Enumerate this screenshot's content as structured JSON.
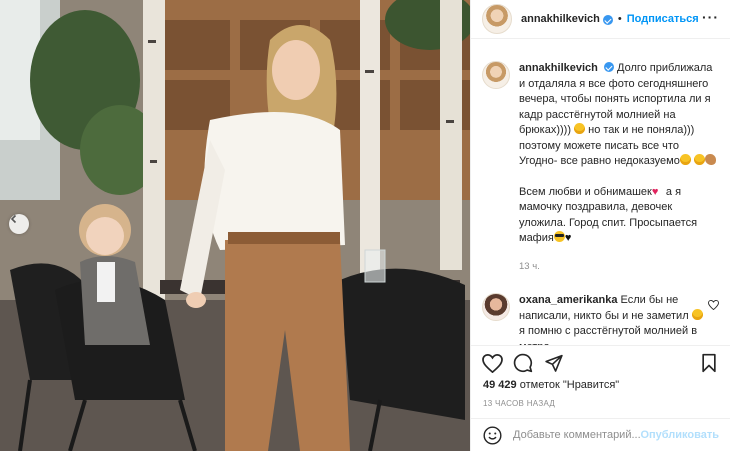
{
  "header": {
    "username": "annakhilkevich",
    "separator": "•",
    "follow_label": "Подписаться",
    "more_icon": "more-horizontal-icon"
  },
  "caption": {
    "username": "annakhilkevich",
    "text_part1": "Долго приближала и отдаляла я все фото сегодняшнего вечера, чтобы понять испортила ли я кадр расстёгнутой молнией на брюках))))",
    "text_part2": " но так и не поняла))) поэтому можете писать все что Угодно- все равно недоказуемо",
    "text_part3": "Всем любви и обнимашек",
    "text_part4": " а я мамочку поздравила, девочек уложила. Город спит. Просыпается мафия",
    "emojis": [
      "laughing-face",
      "laughing-face",
      "laughing-face",
      "flexed-biceps",
      "red-heart",
      "smiling-face-with-sunglasses",
      "black-heart"
    ],
    "time": "13 ч."
  },
  "comment": {
    "username": "oxana_amerikanka",
    "text_part1": " Если бы не написали, никто бы и не заметил",
    "text_part2": " я помню с расстёгнутой молнией в метро"
  },
  "actions": {
    "like_icon": "heart-icon",
    "comment_icon": "comment-icon",
    "share_icon": "share-icon",
    "save_icon": "bookmark-icon"
  },
  "likes": {
    "count": "49 429",
    "label": " отметок \"Нравится\""
  },
  "posted_ago": "13 ЧАСОВ НАЗАД",
  "add_comment": {
    "emoji_icon": "smiley-icon",
    "placeholder": "Добавьте комментарий...",
    "publish_label": "Опубликовать"
  },
  "colors": {
    "accent": "#0095f6",
    "verified": "#3897f0",
    "muted": "#8e8e8e",
    "publish_disabled": "#b2dffc"
  }
}
